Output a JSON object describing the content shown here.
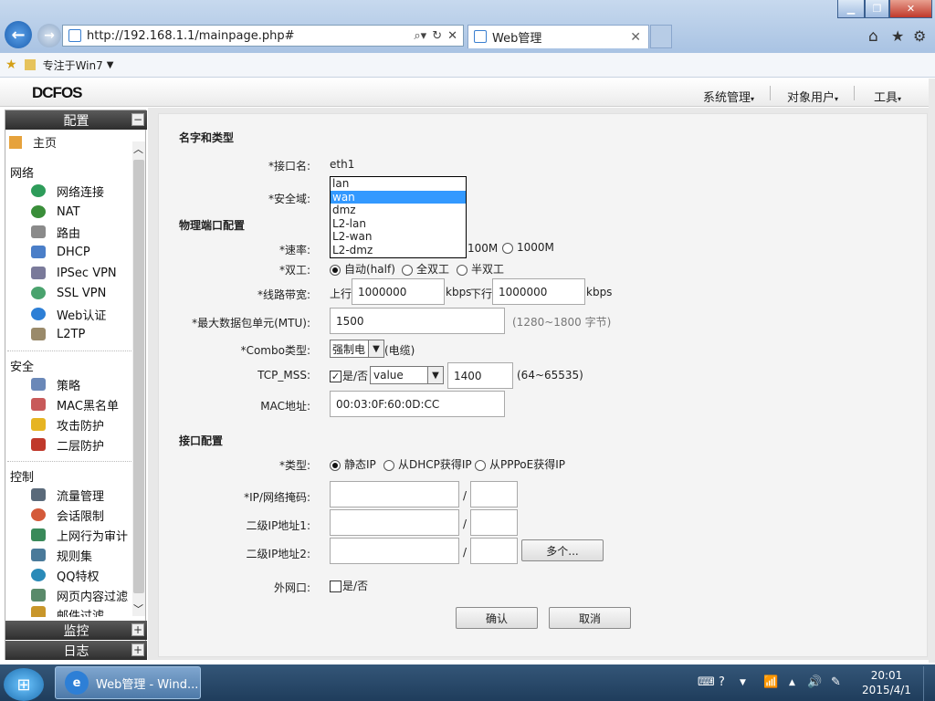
{
  "browser": {
    "url": "http://192.168.1.1/mainpage.php#",
    "tab_title": "Web管理",
    "favorites_label": "专注于Win7"
  },
  "app": {
    "logo": "DCFOS",
    "top_menu": [
      "系统管理",
      "对象用户",
      "工具"
    ]
  },
  "sidebar": {
    "config_title": "配置",
    "monitor_title": "监控",
    "log_title": "日志",
    "home": "主页",
    "groups": {
      "network": "网络",
      "security": "安全",
      "control": "控制"
    },
    "network_items": [
      "网络连接",
      "NAT",
      "路由",
      "DHCP",
      "IPSec VPN",
      "SSL VPN",
      "Web认证",
      "L2TP"
    ],
    "security_items": [
      "策略",
      "MAC黑名单",
      "攻击防护",
      "二层防护"
    ],
    "control_items": [
      "流量管理",
      "会话限制",
      "上网行为审计",
      "规则集",
      "QQ特权",
      "网页内容过滤",
      "邮件过滤"
    ]
  },
  "form": {
    "section_name": "名字和类型",
    "iface_label": "*接口名:",
    "iface_value": "eth1",
    "zone_label": "*安全域:",
    "zone_options": [
      "lan",
      "wan",
      "dmz",
      "L2-lan",
      "L2-wan",
      "L2-dmz"
    ],
    "zone_selected": "wan",
    "section_phys": "物理端口配置",
    "speed_label": "*速率:",
    "speed_opt_100": "100M",
    "speed_opt_1000": "1000M",
    "duplex_label": "*双工:",
    "duplex_auto": "自动(half)",
    "duplex_full": "全双工",
    "duplex_half": "半双工",
    "bw_label": "*线路带宽:",
    "bw_up": "上行",
    "bw_up_value": "1000000",
    "bw_unit1": "kbps",
    "bw_down": "下行",
    "bw_down_value": "1000000",
    "bw_unit2": "kbps",
    "mtu_label": "*最大数据包单元(MTU):",
    "mtu_value": "1500",
    "mtu_hint": "(1280~1800 字节)",
    "combo_label": "*Combo类型:",
    "combo_value": "强制电",
    "combo_suffix": "(电缆)",
    "mss_label": "TCP_MSS:",
    "mss_check": "是/否",
    "mss_select": "value",
    "mss_value": "1400",
    "mss_hint": "(64~65535)",
    "mac_label": "MAC地址:",
    "mac_value": "00:03:0F:60:0D:CC",
    "section_iface": "接口配置",
    "type_label": "*类型:",
    "type_static": "静态IP",
    "type_dhcp": "从DHCP获得IP",
    "type_pppoe": "从PPPoE获得IP",
    "ip_label": "*IP/网络掩码:",
    "ip2_label": "二级IP地址1:",
    "ip3_label": "二级IP地址2:",
    "slash": "/",
    "more_btn": "多个...",
    "wan_label": "外网口:",
    "wan_check": "是/否",
    "ok_btn": "确认",
    "cancel_btn": "取消"
  },
  "taskbar": {
    "item": "Web管理 - Wind...",
    "time": "20:01",
    "date": "2015/4/1"
  }
}
